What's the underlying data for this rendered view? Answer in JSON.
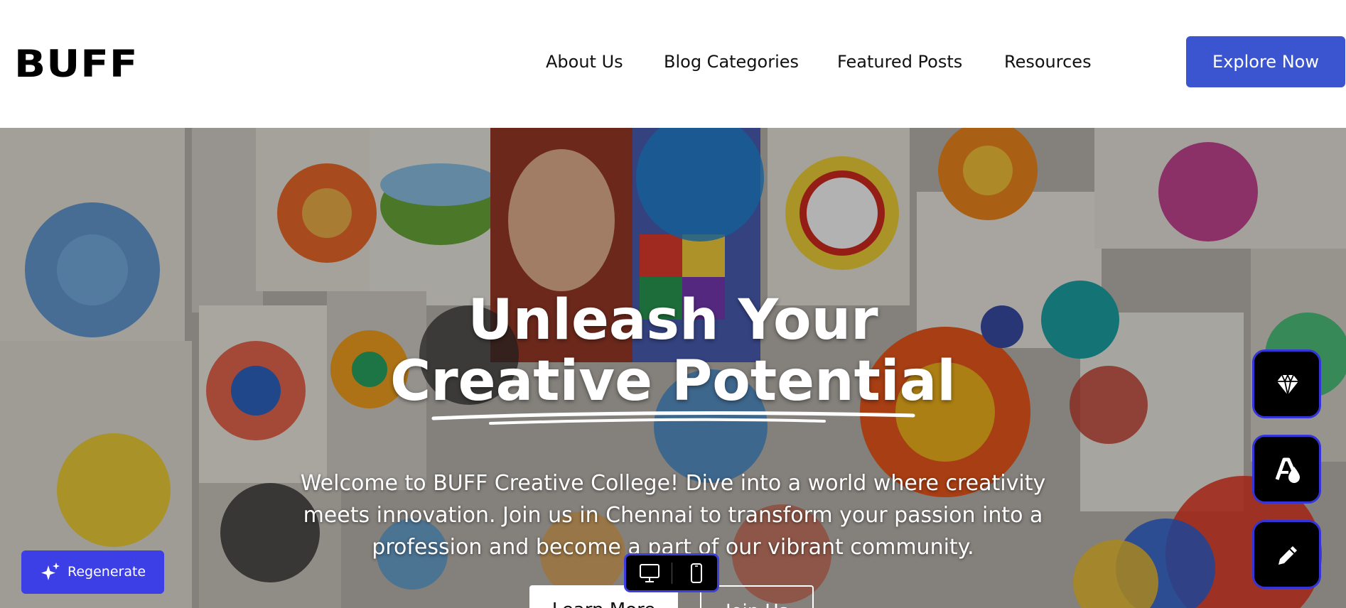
{
  "header": {
    "logo_text": "BUFF",
    "nav": [
      {
        "label": "About Us"
      },
      {
        "label": "Blog Categories"
      },
      {
        "label": "Featured Posts"
      },
      {
        "label": "Resources"
      }
    ],
    "cta_label": "Explore Now",
    "cta_color": "#3b55d1"
  },
  "hero": {
    "title_line1": "Unleash Your",
    "title_line2": "Creative Potential",
    "description": "Welcome to BUFF Creative College! Dive into a world where creativity meets innovation. Join us in Chennai to transform your passion into a profession and become a part of our vibrant community.",
    "primary_button": "Learn More",
    "secondary_button": "Join Us",
    "background_icon": "art-collage-image"
  },
  "controls": {
    "regenerate_label": "Regenerate",
    "regenerate_color": "#3c3ee6",
    "device_toggle": [
      "desktop-icon",
      "mobile-icon"
    ],
    "side_tools": [
      "diamond-icon",
      "shapes-icon",
      "pencil-icon"
    ]
  }
}
